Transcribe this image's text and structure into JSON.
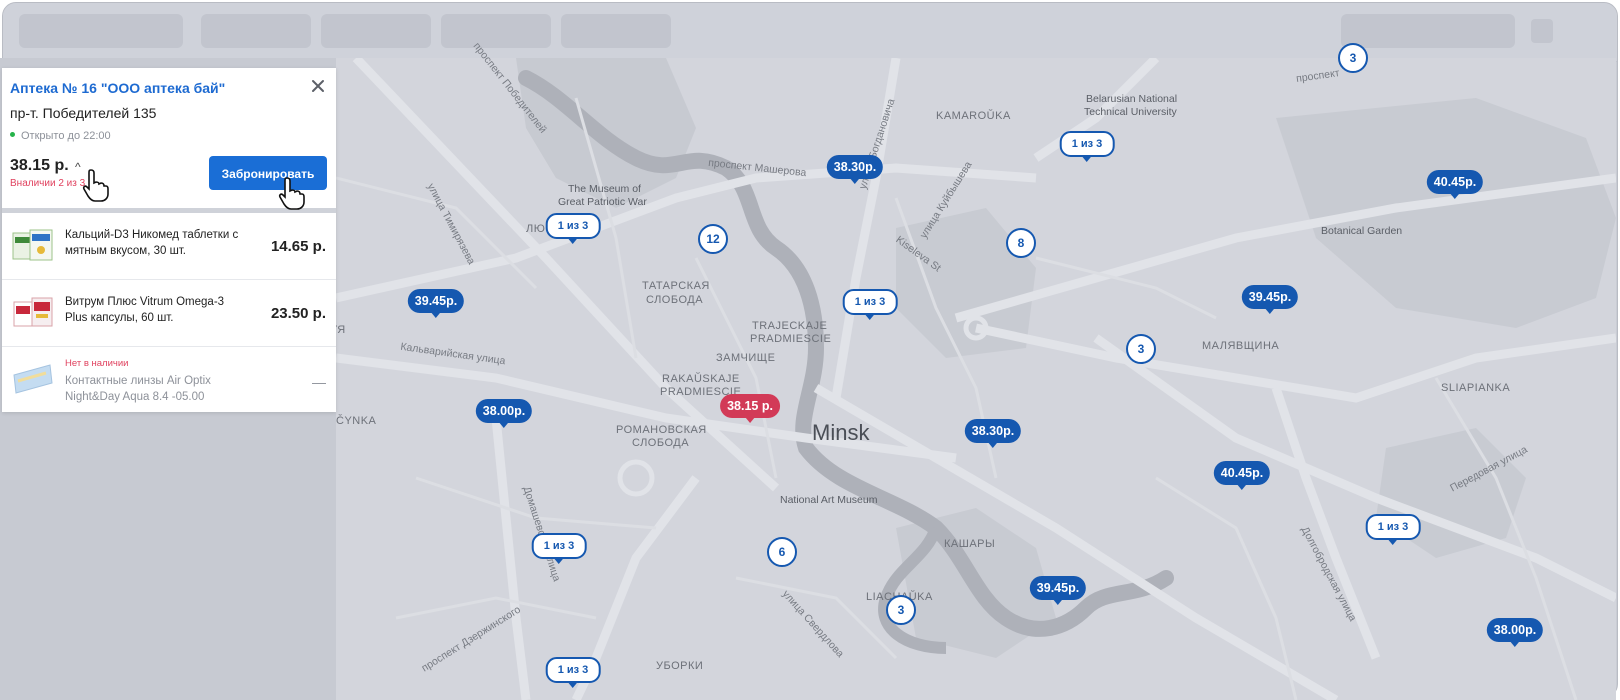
{
  "panel": {
    "title": "Аптека № 16 \"ООО аптека бай\"",
    "address": "пр-т. Победителей 135",
    "status": "Открыто до 22:00",
    "total": "38.15 р.",
    "availability": "Вналичии 2 из 3",
    "book_label": "Забронировать",
    "items": [
      {
        "name": "Кальций-D3 Никомед таблетки с мятным вкусом, 30 шт.",
        "price": "14.65 р."
      },
      {
        "name": "Витрум Плюс Vitrum Omega-3 Plus капсулы, 60 шт.",
        "price": "23.50 р."
      },
      {
        "availability": "Нет в наличии",
        "name": "Контактные линзы Air Optix Night&Day Aqua 8.4 -05.00",
        "price": "—"
      }
    ]
  },
  "map": {
    "city_label": "Minsk",
    "labels": [
      "KAMAROŬKA",
      "Belarusian National",
      "Technical University",
      "Botanical Garden",
      "The Museum of",
      "Great Patriotic War",
      "ТАТАРСКАЯ",
      "СЛОБОДА",
      "TRAJECKAJE",
      "PRADMIESCIE",
      "ЗАМЧИЩЕ",
      "RAKAŬSKAJE",
      "PRADMIESCIE",
      "РОМАНОВСКАЯ",
      "СЛОБОДА",
      "МАЛЯВЩИНА",
      "SLIAPIANKA",
      "National Art Museum",
      "КАШАРЫ",
      "LIACHAŬKA",
      "УБОРКИ",
      "ČYNKA",
      "ЛЮ",
      "УЯ"
    ],
    "streets": [
      "проспект Победителей",
      "проспект Машерова",
      "улица Богдановича",
      "улица Куйбышева",
      "Kiseleva St",
      "улица Тимирязева",
      "Кальварийская улица",
      "Домашевская улица",
      "проспект Дзержинского",
      "улица Свердлова",
      "Долгобродская улица",
      "Передовая улица",
      "проспект"
    ],
    "price_markers": [
      "38.30р.",
      "40.45р.",
      "39.45р.",
      "39.45р.",
      "38.00р.",
      "38.15 р.",
      "38.30р.",
      "40.45р.",
      "39.45р.",
      "38.00р."
    ],
    "count_markers": [
      "1 из 3",
      "1 из 3",
      "1 из 3",
      "1 из 3",
      "1 из 3",
      "1 из 3"
    ],
    "clusters": [
      "12",
      "8",
      "3",
      "6",
      "3",
      "3"
    ]
  },
  "colors": {
    "accent": "#1a6ed6",
    "marker": "#1558b0",
    "marker_active": "#d23a57",
    "in_stock": "#26b34a",
    "out_of_stock": "#e0425f"
  }
}
